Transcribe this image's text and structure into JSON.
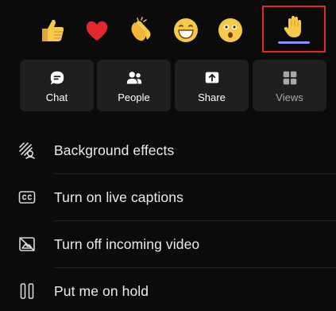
{
  "reactions": [
    {
      "icon": "thumbs-up-icon",
      "label": ""
    },
    {
      "icon": "heart-icon",
      "label": ""
    },
    {
      "icon": "clapping-hands-icon",
      "label": ""
    },
    {
      "icon": "laughing-face-icon",
      "label": ""
    },
    {
      "icon": "surprised-face-icon",
      "label": ""
    },
    {
      "icon": "raise-hand-icon",
      "label": "",
      "selected": true
    }
  ],
  "actions": [
    {
      "icon": "chat-icon",
      "label": "Chat"
    },
    {
      "icon": "people-icon",
      "label": "People"
    },
    {
      "icon": "share-icon",
      "label": "Share"
    },
    {
      "icon": "views-icon",
      "label": "Views"
    }
  ],
  "menu": [
    {
      "icon": "background-effects-icon",
      "label": "Background effects"
    },
    {
      "icon": "closed-captions-icon",
      "label": "Turn on live captions"
    },
    {
      "icon": "video-off-icon",
      "label": "Turn off incoming video"
    },
    {
      "icon": "pause-icon",
      "label": "Put me on hold"
    }
  ],
  "colors": {
    "background": "#0b0b0b",
    "tile": "#1f1f1f",
    "highlight": "#e0282e",
    "selected_underline": "#8a8fff",
    "emoji_yellow": "#f7c948",
    "heart_red": "#e0282e"
  }
}
